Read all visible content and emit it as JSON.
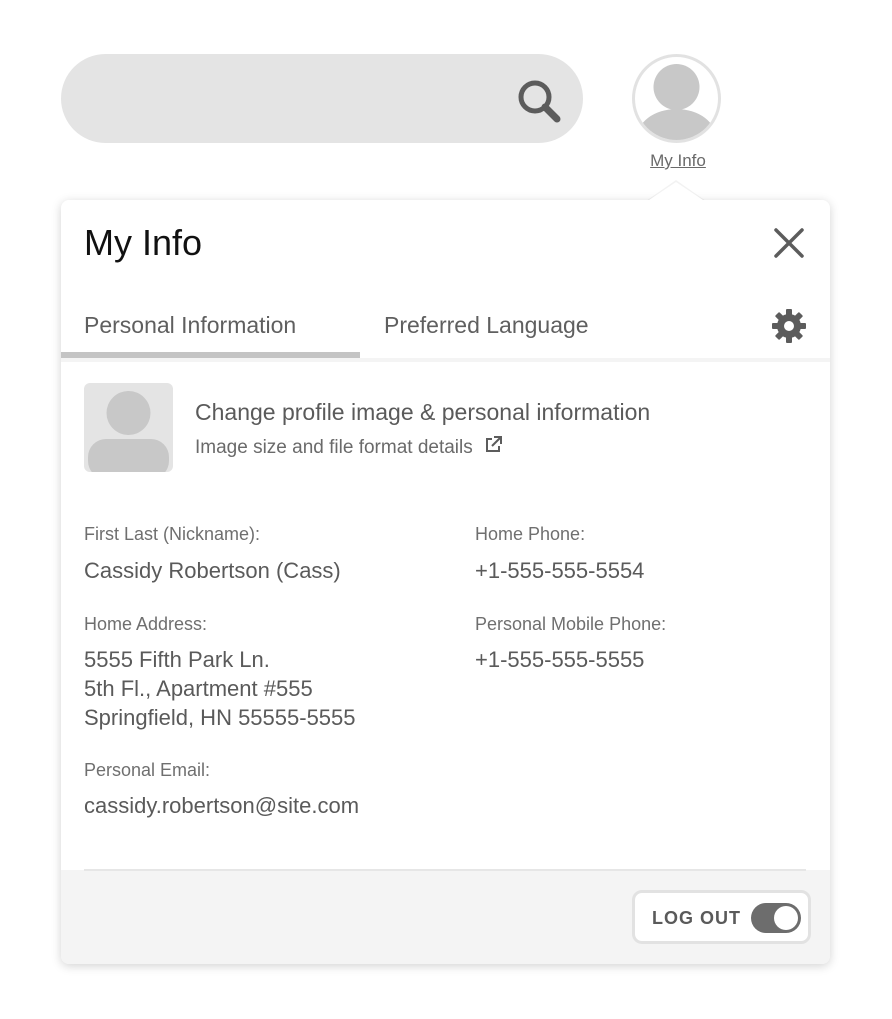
{
  "header": {
    "search": {
      "value": "",
      "placeholder": "",
      "icon": "search-icon"
    },
    "account": {
      "icon": "avatar-icon",
      "link_label": "My Info"
    }
  },
  "panel": {
    "title": "My Info",
    "close_icon": "close-icon",
    "settings_icon": "gear-icon",
    "tabs": [
      {
        "label": "Personal Information",
        "active": true
      },
      {
        "label": "Preferred Language",
        "active": false
      }
    ],
    "profile": {
      "title": "Change profile image & personal information",
      "subtitle": "Image size and file format details",
      "subtitle_icon": "external-link-icon"
    },
    "fields": {
      "name": {
        "label": "First Last (Nickname):",
        "value": "Cassidy Robertson (Cass)"
      },
      "home_phone": {
        "label": "Home Phone:",
        "value": "+1-555-555-5554"
      },
      "home_address": {
        "label": "Home Address:",
        "value": "5555 Fifth Park Ln.\n5th Fl., Apartment #555\nSpringfield, HN 55555-5555"
      },
      "mobile_phone": {
        "label": "Personal Mobile Phone:",
        "value": "+1-555-555-5555"
      },
      "email": {
        "label": "Personal Email:",
        "value": "cassidy.robertson@site.com"
      }
    },
    "footer": {
      "logout_label": "LOG OUT",
      "logout_toggle_on": true
    }
  },
  "colors": {
    "surface_gray": "#e4e4e4",
    "footer_gray": "#f4f4f4",
    "text_dark": "#111111",
    "text_gray": "#5a5a5a",
    "toggle_gray": "#6d6d6d"
  }
}
